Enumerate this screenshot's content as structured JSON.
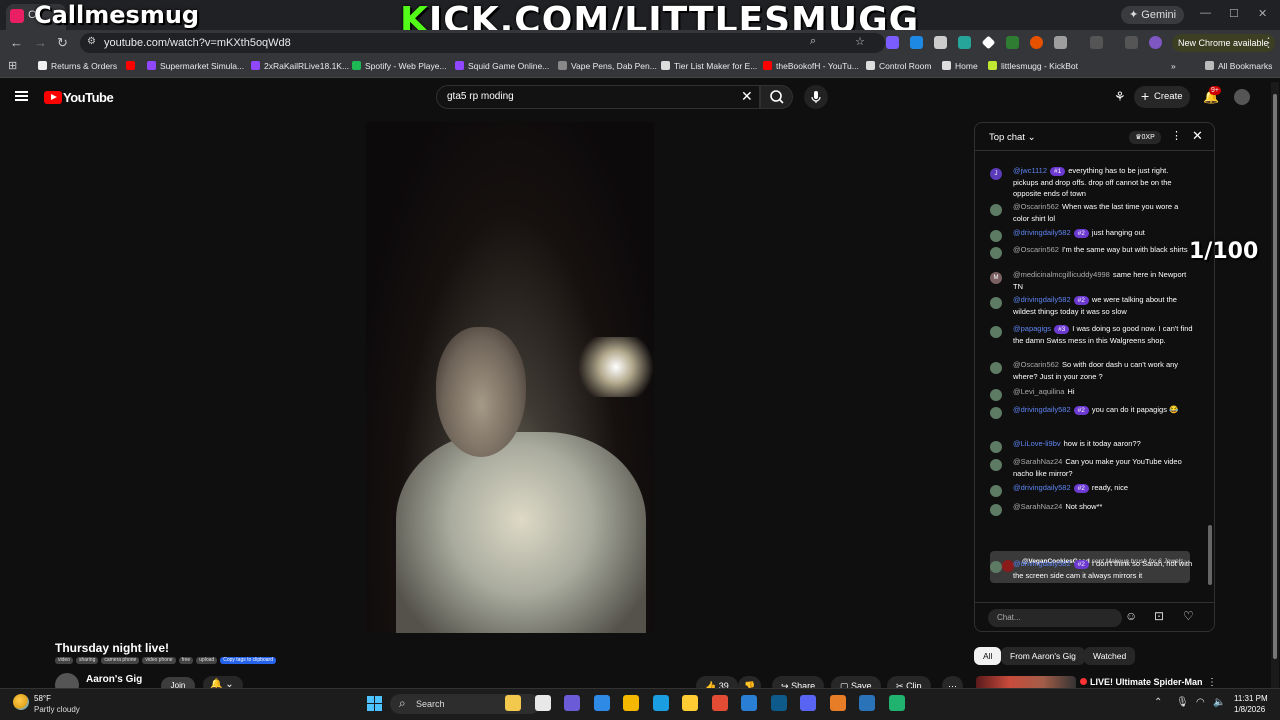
{
  "browser": {
    "tab_title": "C",
    "url": "youtube.com/watch?v=mKXth5oqWd8",
    "gemini_label": "Gemini",
    "new_chrome_label": "New Chrome available",
    "bookmarks": [
      {
        "label": "Returns & Orders",
        "color": "#f0f0f0"
      },
      {
        "label": "",
        "color": "#ff0000"
      },
      {
        "label": "Supermarket Simula...",
        "color": "#9146ff"
      },
      {
        "label": "2xRaKailRLive18.1K...",
        "color": "#9146ff"
      },
      {
        "label": "Spotify - Web Playe...",
        "color": "#1db954"
      },
      {
        "label": "Squid Game Online...",
        "color": "#9146ff"
      },
      {
        "label": "Vape Pens, Dab Pen...",
        "color": "#888888"
      },
      {
        "label": "Tier List Maker for E...",
        "color": "#dddddd"
      },
      {
        "label": "theBookofH - YouTu...",
        "color": "#ff0000"
      },
      {
        "label": "Control Room",
        "color": "#dddddd"
      },
      {
        "label": "Home",
        "color": "#dddddd"
      },
      {
        "label": "littlesmugg - KickBot",
        "color": "#c0e832"
      }
    ],
    "all_bookmarks_label": "All Bookmarks"
  },
  "overlay": {
    "streamer_name": "Callmesmug",
    "kick_prefix": "K",
    "kick_rest": "ICK.COM/LITTLESMUGG",
    "counter": "1/100"
  },
  "youtube": {
    "logo_text": "YouTube",
    "search_query": "gta5 rp moding",
    "create_label": "Create",
    "notif_count": "9+"
  },
  "video": {
    "title": "Thursday night live!",
    "tags": [
      "video",
      "sharing",
      "camera phone",
      "video phone",
      "free",
      "upload"
    ],
    "copy_tags_label": "Copy tags to clipboard",
    "channel_name": "Aaron's Gig",
    "join_label": "Join",
    "like_count": "39",
    "share_label": "Share",
    "save_label": "Save",
    "clip_label": "Clip"
  },
  "chat": {
    "header_label": "Top chat",
    "xp_label": "0XP",
    "input_placeholder": "Chat...",
    "messages": [
      {
        "avatar": "J",
        "user": "@jwc1112",
        "mod": true,
        "rank": "#1",
        "text": "everything has to be just right. pickups and drop offs. drop off cannot be on the opposite ends of town"
      },
      {
        "avatar": "",
        "user": "@Oscarin562",
        "mod": false,
        "rank": "",
        "text": "When was the last time you wore a color shirt lol"
      },
      {
        "avatar": "",
        "user": "@drivingdaily582",
        "mod": true,
        "rank": "#2",
        "text": "just hanging out"
      },
      {
        "avatar": "",
        "user": "@Oscarin562",
        "mod": false,
        "rank": "",
        "text": "I'm the same way but with black shirts"
      },
      {
        "avatar": "M",
        "user": "@medicinalmcgillicuddy4998",
        "mod": false,
        "rank": "",
        "text": "same here in Newport TN"
      },
      {
        "avatar": "",
        "user": "@drivingdaily582",
        "mod": true,
        "rank": "#2",
        "text": "we were talking about the wildest things today it was so slow"
      },
      {
        "avatar": "",
        "user": "@papagigs",
        "mod": true,
        "rank": "#3",
        "text": "I was doing so good now. I can't find the damn Swiss mess in this Walgreens shop."
      },
      {
        "avatar": "",
        "user": "@Oscarin562",
        "mod": false,
        "rank": "",
        "text": "So with door dash u can't work any where? Just in your zone ?"
      },
      {
        "avatar": "",
        "user": "@Levi_aquilina",
        "mod": false,
        "rank": "",
        "text": "Hi"
      },
      {
        "avatar": "",
        "user": "@drivingdaily582",
        "mod": true,
        "rank": "#2",
        "text": "you can do it papagigs 😂"
      },
      {
        "avatar": "",
        "user": "@LiLove-li9bv",
        "mod": true,
        "rank": "",
        "text": "how is it today aaron??"
      },
      {
        "avatar": "",
        "user": "@SarahNaz24",
        "mod": false,
        "rank": "",
        "text": "Can you make your YouTube video nacho like mirror?"
      },
      {
        "avatar": "",
        "user": "@drivingdaily582",
        "mod": true,
        "rank": "#2",
        "text": "ready, nice"
      },
      {
        "avatar": "",
        "user": "@SarahNaz24",
        "mod": false,
        "rank": "",
        "text": "Not show**"
      }
    ],
    "gift": {
      "user": "@VeganCookiesGood",
      "text": "sent Makeup brush for 6 Jewels"
    },
    "last_message": {
      "user": "@drivingdaily582",
      "mod": true,
      "rank": "#2",
      "text": "I don't think so Sarah, not with the screen side cam it always mirrors it"
    }
  },
  "chips": [
    "All",
    "From Aaron's Gig",
    "Watched"
  ],
  "recommendation": {
    "live_label": "LIVE",
    "title": "LIVE! Ultimate Spider-Man"
  },
  "taskbar": {
    "temperature": "58°F",
    "weather_desc": "Partly cloudy",
    "search_label": "Search",
    "time": "11:31 PM",
    "date": "1/8/2026",
    "apps": [
      "#f2c94c",
      "#e8e8e8",
      "#6b5bd6",
      "#2f8ae5",
      "#f5b800",
      "#1b9de2",
      "#ffcc33",
      "#e44b35",
      "#2a7fd4",
      "#0e5a8a",
      "#5865f2",
      "#e87d27",
      "#2b73b9",
      "#20b36f"
    ]
  }
}
